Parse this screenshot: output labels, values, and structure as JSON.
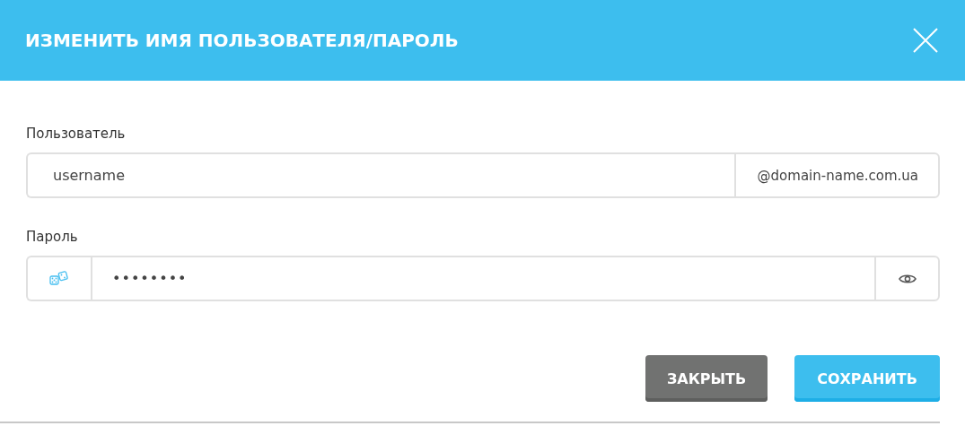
{
  "dialog": {
    "title": "ИЗМЕНИТЬ ИМЯ ПОЛЬЗОВАТЕЛЯ/ПАРОЛЬ"
  },
  "username": {
    "label": "Пользователь",
    "value": "username",
    "suffix": "@domain-name.com.ua"
  },
  "password": {
    "label": "Пароль",
    "value": "••••••••"
  },
  "buttons": [
    {
      "label": "ЗАКРЫТЬ",
      "kind": "secondary"
    },
    {
      "label": "СОХРАНИТЬ",
      "kind": "primary"
    }
  ]
}
